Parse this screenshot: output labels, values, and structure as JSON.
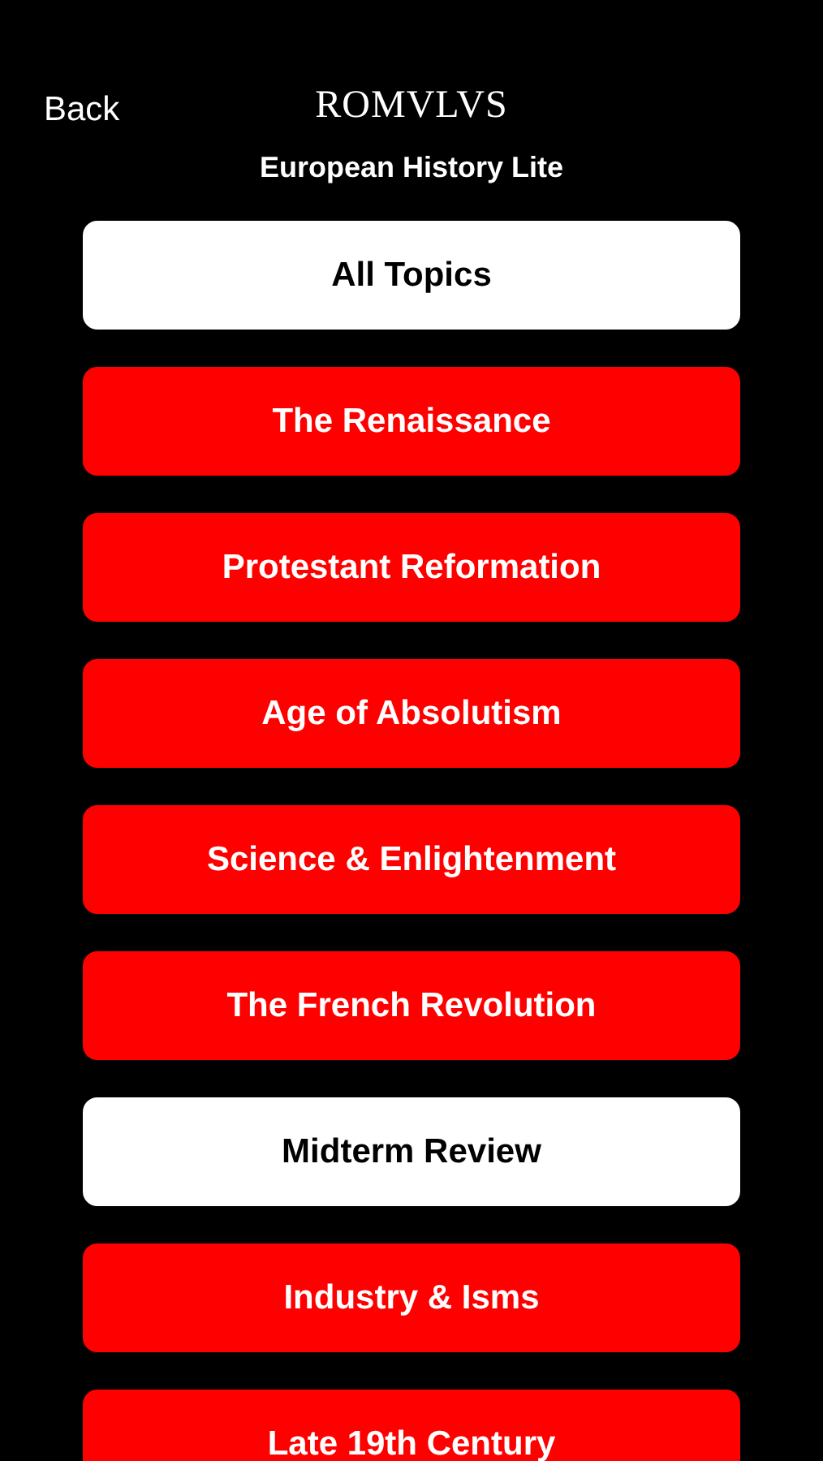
{
  "header": {
    "back": "Back",
    "logo": "ROMVLVS",
    "subtitle": "European History Lite"
  },
  "topics": [
    {
      "label": "All Topics",
      "kind": "plain"
    },
    {
      "label": "The Renaissance",
      "kind": "topic"
    },
    {
      "label": "Protestant Reformation",
      "kind": "topic"
    },
    {
      "label": "Age of Absolutism",
      "kind": "topic"
    },
    {
      "label": "Science & Enlightenment",
      "kind": "topic"
    },
    {
      "label": "The French Revolution",
      "kind": "topic"
    },
    {
      "label": "Midterm Review",
      "kind": "plain"
    },
    {
      "label": "Industry & Isms",
      "kind": "topic"
    },
    {
      "label": "Late 19th Century",
      "kind": "topic"
    }
  ]
}
